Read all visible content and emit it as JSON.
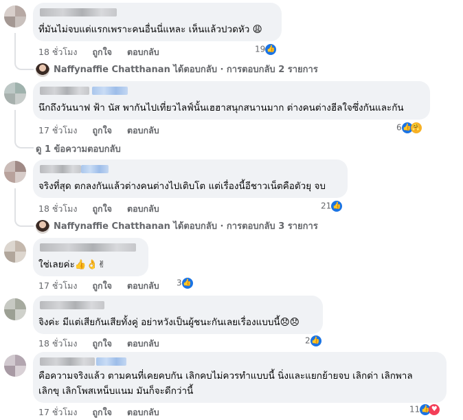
{
  "comments": [
    {
      "text": "ที่มันไม่จบแต่แรกเพราะคนอื่นนี่แหละ เห็นแล้วปวดหัว 😩",
      "time": "18 ชั่วโมง",
      "like": "ถูกใจ",
      "reply": "ตอบกลับ",
      "reaction_count": "19",
      "reactions": [
        "like-icon"
      ],
      "reply_summary": {
        "name": "Naffynaffie Chatthanan",
        "text": "ได้ตอบกลับ · การตอบกลับ 2 รายการ"
      }
    },
    {
      "text": "นึกถึงวันนาฟ ฟ้า นัส พากันไปเที่ยวไลฟ์นั้นเฮฮาสนุกสนานมาก ต่างคนต่างฮีลใจซึ่งกันและกัน",
      "time": "17 ชั่วโมง",
      "like": "ถูกใจ",
      "reply": "ตอบกลับ",
      "reaction_count": "6",
      "reactions": [
        "like-icon",
        "care-icon"
      ],
      "view_replies": "ดู 1 ข้อความตอบกลับ"
    },
    {
      "text": "จริงที่สุด ตกลงกันแล้วต่างคนต่างไปเติบโต แต่เรื่องนี้อีชาวเน็ตคือตัวยุ จบ",
      "time": "18 ชั่วโมง",
      "like": "ถูกใจ",
      "reply": "ตอบกลับ",
      "reaction_count": "21",
      "reactions": [
        "like-icon"
      ],
      "reply_summary": {
        "name": "Naffynaffie Chatthanan",
        "text": "ได้ตอบกลับ · การตอบกลับ 3 รายการ"
      }
    },
    {
      "text": "ใช่เลยค่ะ👍👌✌",
      "time": "17 ชั่วโมง",
      "like": "ถูกใจ",
      "reply": "ตอบกลับ",
      "reaction_count": "3",
      "reactions": [
        "like-icon"
      ]
    },
    {
      "text": "จิงค่ะ มีแต่เสียกันเสียทั้งคู่ อย่าหวังเป็นผู้ชนะกันเลยเรื่องแบบนี้😞😞",
      "time": "18 ชั่วโมง",
      "like": "ถูกใจ",
      "reply": "ตอบกลับ",
      "reaction_count": "2",
      "reactions": [
        "like-icon"
      ]
    },
    {
      "text_line1": "คือความจริงแล้ว ตามคนที่เคยคบกัน เลิกคบไม่ควรทำแบบนี้ นิ่งและแยกย้ายจบ เลิกด่า เลิกพาล",
      "text_line2": "เลิกขุ เลิกโพสเหน็บแนม มันก็จะดีกว่านี้",
      "time": "17 ชั่วโมง",
      "like": "ถูกใจ",
      "reply": "ตอบกลับ",
      "reaction_count": "11",
      "reactions": [
        "like-icon",
        "love-icon"
      ]
    }
  ],
  "colors": {
    "bubble": "#f0f2f5",
    "meta": "#65676b",
    "like": "#1b74e4",
    "love": "#f33e58"
  }
}
